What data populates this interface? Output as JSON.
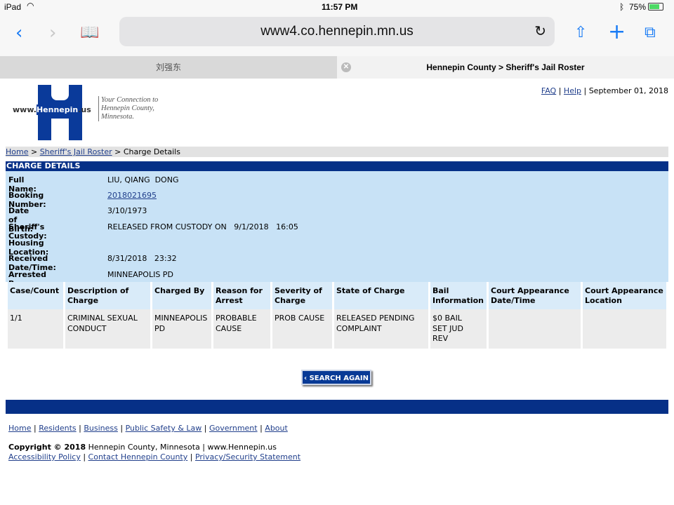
{
  "status_bar": {
    "device": "iPad",
    "time": "11:57 PM",
    "battery": "75%"
  },
  "browser": {
    "url": "www4.co.hennepin.mn.us",
    "tabs": [
      {
        "label": "刘强东",
        "active": false
      },
      {
        "label": "Hennepin County > Sheriff's Jail Roster",
        "active": true
      }
    ]
  },
  "logo": {
    "text": "www.Hennepin.us",
    "tagline": "Your Connection to Hennepin County, Minnesota."
  },
  "top_links": {
    "faq": "FAQ",
    "help": "Help",
    "date": "September 01, 2018"
  },
  "breadcrumb": {
    "home": "Home",
    "roster": "Sheriff's Jail Roster",
    "current": "Charge Details"
  },
  "section_title": "CHARGE DETAILS",
  "details": [
    {
      "label": "Full Name:",
      "value": "LIU, QIANG  DONG"
    },
    {
      "label": "Booking Number:",
      "value": "2018021695",
      "link": true
    },
    {
      "label": "Date of Birth:",
      "value": "3/10/1973"
    },
    {
      "label": "Sheriff's Custody:",
      "value": "RELEASED FROM CUSTODY ON   9/1/2018   16:05"
    },
    {
      "label": "Housing Location:",
      "value": ""
    },
    {
      "label": "Received Date/Time:",
      "value": "8/31/2018   23:32"
    },
    {
      "label": "Arrested By:",
      "value": "MINNEAPOLIS PD"
    }
  ],
  "charges": {
    "headers": [
      "Case/Count",
      "Description of Charge",
      "Charged By",
      "Reason for Arrest",
      "Severity of Charge",
      "State of Charge",
      "Bail Information",
      "Court Appearance Date/Time",
      "Court Appearance Location"
    ],
    "rows": [
      [
        "1/1",
        "CRIMINAL SEXUAL CONDUCT",
        "MINNEAPOLIS PD",
        "PROBABLE CAUSE",
        "PROB CAUSE",
        "RELEASED PENDING COMPLAINT",
        "$0 BAIL SET JUD REV",
        "",
        ""
      ]
    ]
  },
  "search_again": "‹ SEARCH AGAIN",
  "footer": {
    "links": [
      "Home",
      "Residents",
      "Business",
      "Public Safety & Law",
      "Government",
      "About"
    ],
    "copyright_bold": "Copyright © 2018",
    "copyright_rest": " Hennepin County, Minnesota | www.Hennepin.us",
    "links2": [
      "Accessibility Policy",
      "Contact Hennepin County",
      "Privacy/Security Statement"
    ]
  },
  "colors": {
    "navy": "#063087",
    "light_blue": "#c8e2f6",
    "link": "#22408c"
  }
}
